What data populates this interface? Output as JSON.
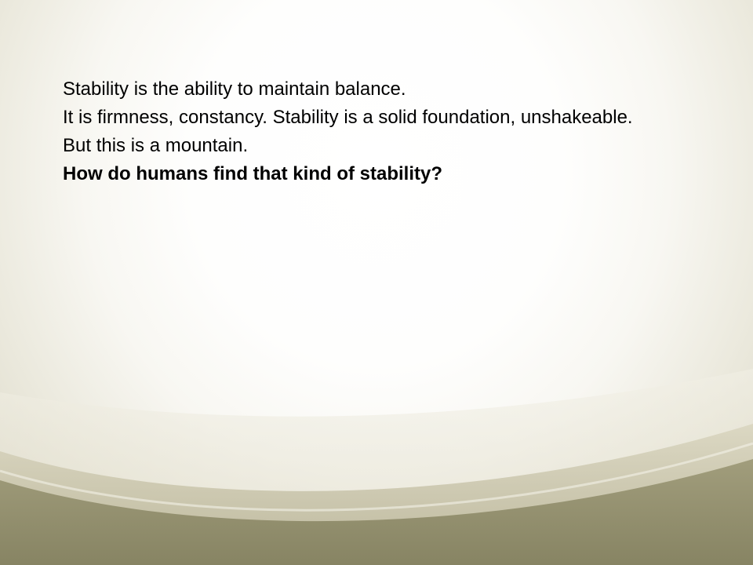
{
  "slide": {
    "lines": [
      "Stability is the ability to maintain balance.",
      "It is firmness, constancy. Stability is a solid foundation, unshakeable.",
      "But this is a mountain.",
      "How do humans find that kind of stability?"
    ]
  },
  "colors": {
    "background_light": "#ffffff",
    "swoosh_light": "#e6e3d4",
    "swoosh_mid": "#c9c5ac",
    "swoosh_dark": "#8f8c6c",
    "text": "#000000"
  }
}
